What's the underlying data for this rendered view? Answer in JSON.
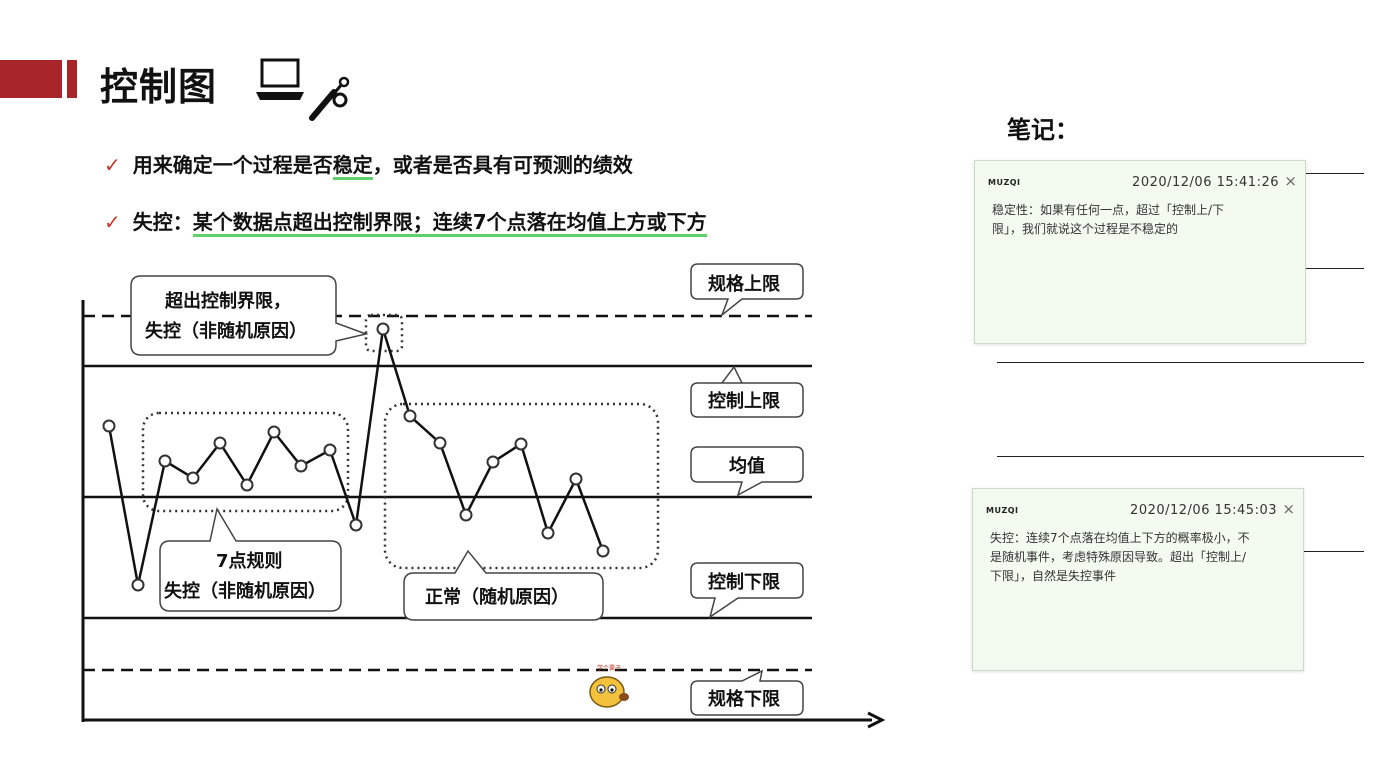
{
  "title": "控制图",
  "bullets": [
    {
      "pre": "用来确定一个过程是否",
      "hl": "稳定",
      "post": "，或者是否具有可预测的绩效"
    },
    {
      "pre": "失控：",
      "hl": "某个数据点超出控制界限；连续7个点落在均值上方或下方",
      "post": ""
    }
  ],
  "diagram": {
    "labels": {
      "spec_upper": "规格上限",
      "control_upper": "控制上限",
      "mean": "均值",
      "control_lower": "控制下限",
      "spec_lower": "规格下限"
    },
    "callouts": {
      "out_of_limit_1": "超出控制界限，",
      "out_of_limit_2": "失控（非随机原因）",
      "rule7_1": "7点规则",
      "rule7_2": "失控（非随机原因）",
      "normal": "正常（随机原因）"
    },
    "sticker_text": "学个囊子"
  },
  "notes": {
    "heading": "笔记：",
    "items": [
      {
        "author": "MUZQI",
        "time": "2020/12/06 15:41:26",
        "close": "×",
        "text": "稳定性：如果有任何一点，超过「控制上/下限」，我们就说这个过程是不稳定的"
      },
      {
        "author": "MUZQI",
        "time": "2020/12/06 15:45:03",
        "close": "×",
        "text": "失控：连续7个点落在均值上下方的概率极小，不是随机事件，考虑特殊原因导致。超出「控制上/下限」，自然是失控事件"
      }
    ]
  },
  "colors": {
    "accent": "#a8262a",
    "check": "#c0392b",
    "underline": "#5fd06a",
    "note_bg": "#f3fbf1"
  }
}
